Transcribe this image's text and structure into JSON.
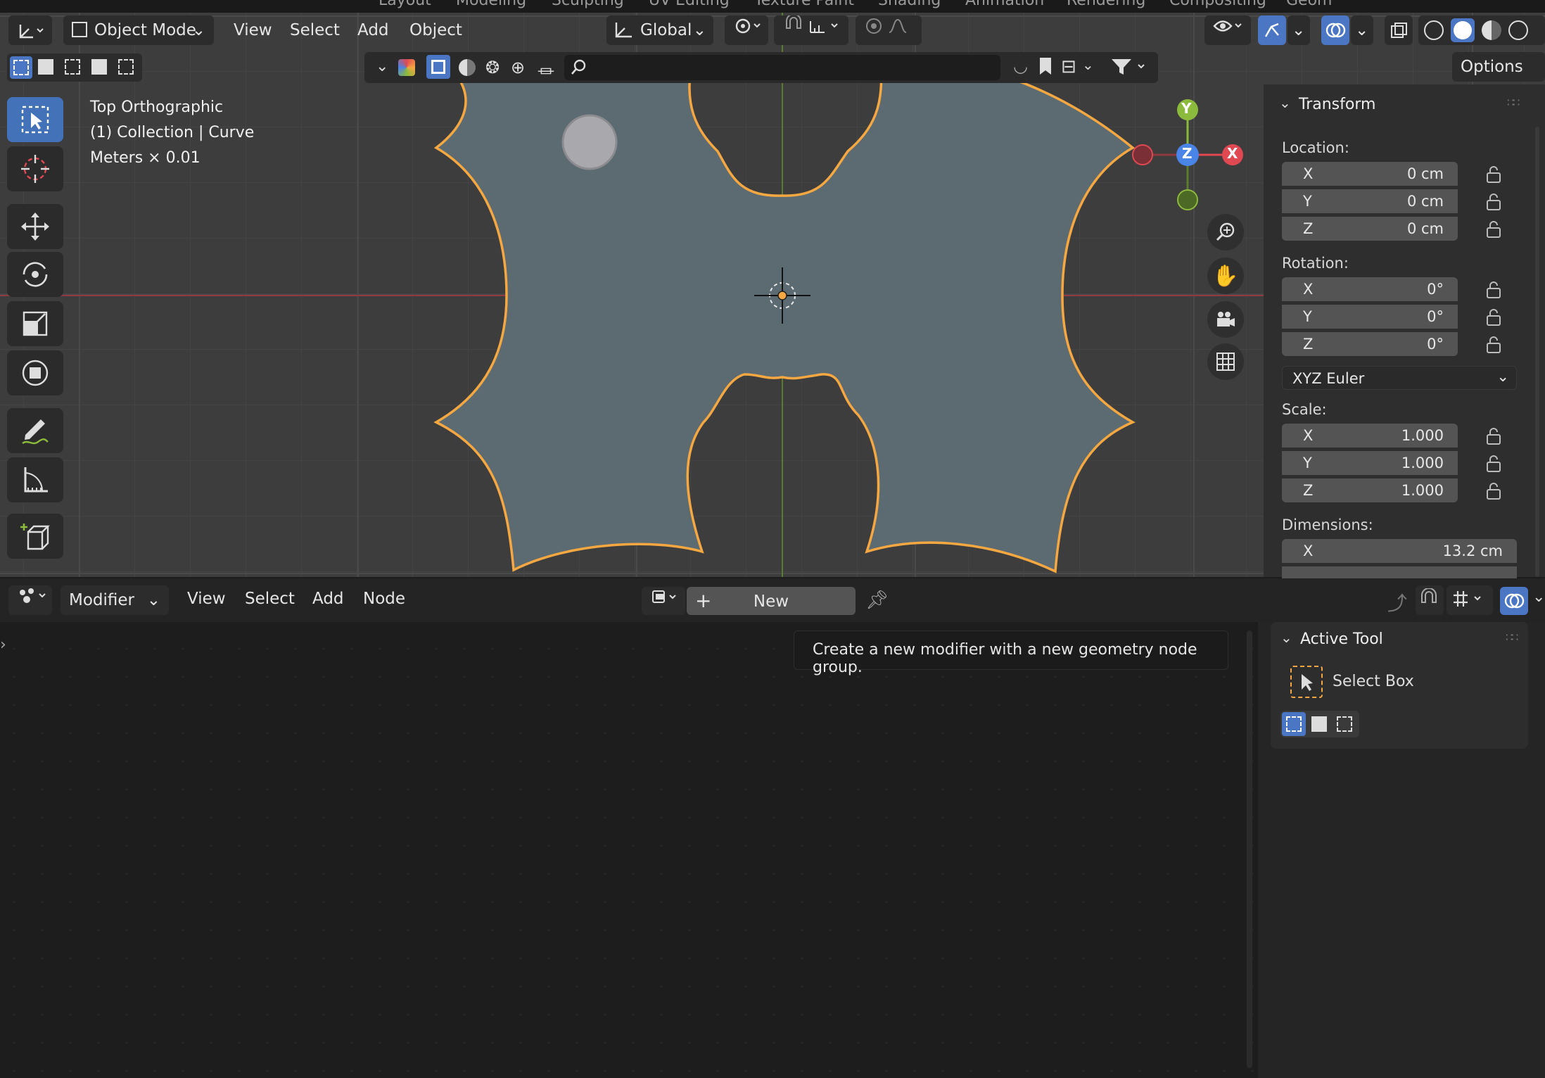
{
  "top_tabs": [
    "Layout",
    "Modeling",
    "Sculpting",
    "UV Editing",
    "Texture Paint",
    "Shading",
    "Animation",
    "Rendering",
    "Compositing",
    "Geom"
  ],
  "viewport_header": {
    "mode": "Object Mode",
    "menus": [
      "View",
      "Select",
      "Add",
      "Object"
    ],
    "transform_orientation": "Global",
    "options_label": "Options"
  },
  "overlay_info": {
    "view_name": "Top Orthographic",
    "collection": "(1) Collection | Curve",
    "units": "Meters × 0.01"
  },
  "gizmo": {
    "y": "Y",
    "z": "Z",
    "x": "X"
  },
  "transform_panel": {
    "title": "Transform",
    "location_label": "Location:",
    "location": [
      {
        "axis": "X",
        "value": "0 cm"
      },
      {
        "axis": "Y",
        "value": "0 cm"
      },
      {
        "axis": "Z",
        "value": "0 cm"
      }
    ],
    "rotation_label": "Rotation:",
    "rotation": [
      {
        "axis": "X",
        "value": "0°"
      },
      {
        "axis": "Y",
        "value": "0°"
      },
      {
        "axis": "Z",
        "value": "0°"
      }
    ],
    "rotation_mode": "XYZ Euler",
    "scale_label": "Scale:",
    "scale": [
      {
        "axis": "X",
        "value": "1.000"
      },
      {
        "axis": "Y",
        "value": "1.000"
      },
      {
        "axis": "Z",
        "value": "1.000"
      }
    ],
    "dimensions_label": "Dimensions:",
    "dimensions": [
      {
        "axis": "X",
        "value": "13.2 cm"
      }
    ]
  },
  "node_editor": {
    "editor_type": "Modifier",
    "menus": [
      "View",
      "Select",
      "Add",
      "Node"
    ],
    "new_label": "New",
    "tooltip": "Create a new modifier with a new geometry node group."
  },
  "active_tool_panel": {
    "title": "Active Tool",
    "tool_name": "Select Box"
  },
  "colors": {
    "accent": "#4772b3",
    "selection_outline": "#f5a742",
    "shape_fill": "#5b6b71",
    "x_axis": "#e04852",
    "y_axis": "#8cba3c",
    "z_axis": "#4a84e6"
  }
}
